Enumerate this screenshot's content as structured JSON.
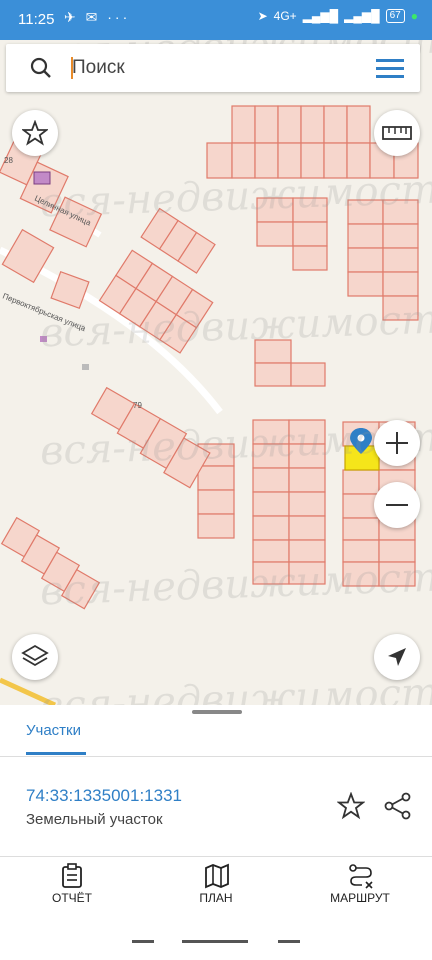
{
  "status": {
    "time": "11:25",
    "battery": "67",
    "network": "4G+"
  },
  "search": {
    "placeholder": "Поиск"
  },
  "map": {
    "labels": {
      "street1": "Целинная улица",
      "street2": "Первоктябрьская улица",
      "house28": "28",
      "house79": "79"
    }
  },
  "watermark": "вся-недвижимость.ne",
  "tabs": {
    "active": "Участки"
  },
  "parcel": {
    "cadastral_number": "74:33:1335001:1331",
    "type": "Земельный участок"
  },
  "nav": {
    "report": "ОТЧЁТ",
    "plan": "ПЛАН",
    "route": "МАРШРУТ"
  },
  "colors": {
    "accent": "#2f7fc6",
    "parcel_outline": "#e07a6a",
    "parcel_fill": "#f6d6cc",
    "selected": "#f5e51a"
  }
}
